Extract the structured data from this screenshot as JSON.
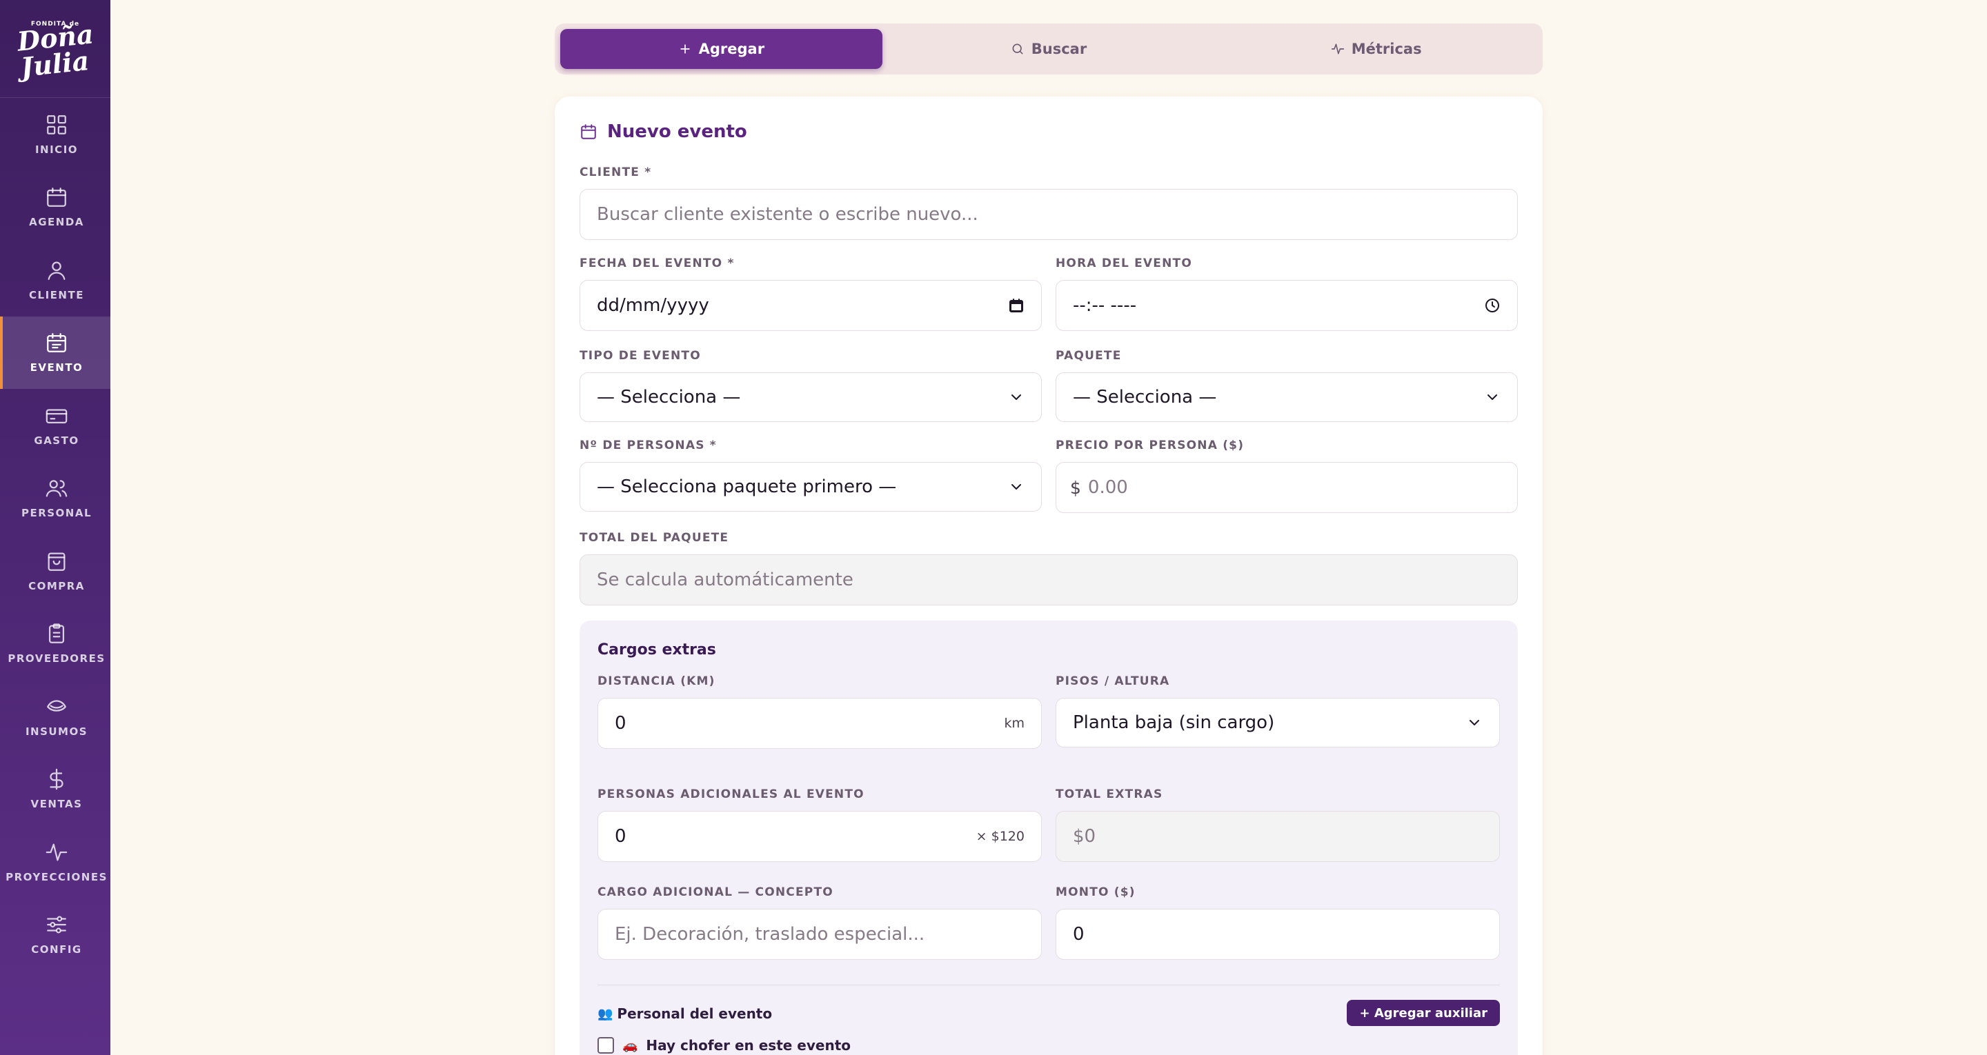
{
  "brand": {
    "small": "FONDITA de",
    "name_line1": "Doña",
    "name_line2": "Julia"
  },
  "sidebar": {
    "items": [
      {
        "label": "INICIO",
        "icon": "grid-icon"
      },
      {
        "label": "AGENDA",
        "icon": "calendar-icon"
      },
      {
        "label": "CLIENTE",
        "icon": "user-icon"
      },
      {
        "label": "EVENTO",
        "icon": "calendar-check-icon",
        "active": true
      },
      {
        "label": "GASTO",
        "icon": "card-icon"
      },
      {
        "label": "PERSONAL",
        "icon": "users-icon"
      },
      {
        "label": "COMPRA",
        "icon": "shopping-bag-icon"
      },
      {
        "label": "PROVEEDORES",
        "icon": "clipboard-icon"
      },
      {
        "label": "INSUMOS",
        "icon": "ingredients-icon"
      },
      {
        "label": "VENTAS",
        "icon": "dollar-icon"
      },
      {
        "label": "PROYECCIONES",
        "icon": "activity-icon"
      },
      {
        "label": "CONFIG",
        "icon": "sliders-icon"
      }
    ]
  },
  "tabs": [
    {
      "label": "Agregar",
      "icon": "plus-icon",
      "active": true
    },
    {
      "label": "Buscar",
      "icon": "search-icon"
    },
    {
      "label": "Métricas",
      "icon": "activity-icon"
    }
  ],
  "form": {
    "title": "Nuevo evento",
    "cliente": {
      "label": "CLIENTE *",
      "placeholder": "Buscar cliente existente o escribe nuevo..."
    },
    "fecha": {
      "label": "FECHA DEL EVENTO *",
      "value": "dd/mm/yyyy"
    },
    "hora": {
      "label": "HORA DEL EVENTO",
      "value": "--:-- ----"
    },
    "tipo": {
      "label": "TIPO DE EVENTO",
      "value": "— Selecciona —"
    },
    "paquete": {
      "label": "PAQUETE",
      "value": "— Selecciona —"
    },
    "personas": {
      "label": "Nº DE PERSONAS *",
      "value": "— Selecciona paquete primero —"
    },
    "precio": {
      "label": "PRECIO POR PERSONA ($)",
      "prefix": "$",
      "placeholder": "0.00"
    },
    "total": {
      "label": "TOTAL DEL PAQUETE",
      "value": "Se calcula automáticamente"
    }
  },
  "extras": {
    "title": "Cargos extras",
    "distancia": {
      "label": "DISTANCIA (KM)",
      "value": "0",
      "suffix": "km"
    },
    "pisos": {
      "label": "PISOS / ALTURA",
      "value": "Planta baja (sin cargo)"
    },
    "adicionales": {
      "label": "PERSONAS ADICIONALES AL EVENTO",
      "value": "0",
      "suffix": "× $120"
    },
    "total_extras": {
      "label": "TOTAL EXTRAS",
      "value": "$0"
    },
    "concepto": {
      "label": "CARGO ADICIONAL — CONCEPTO",
      "placeholder": "Ej. Decoración, traslado especial..."
    },
    "monto": {
      "label": "MONTO ($)",
      "value": "0"
    },
    "staff_title": "Personal del evento",
    "staff_emoji": "👥",
    "add_aux": "+ Agregar auxiliar",
    "driver_label": "Hay chofer en este evento",
    "driver_emoji": "🚗"
  }
}
